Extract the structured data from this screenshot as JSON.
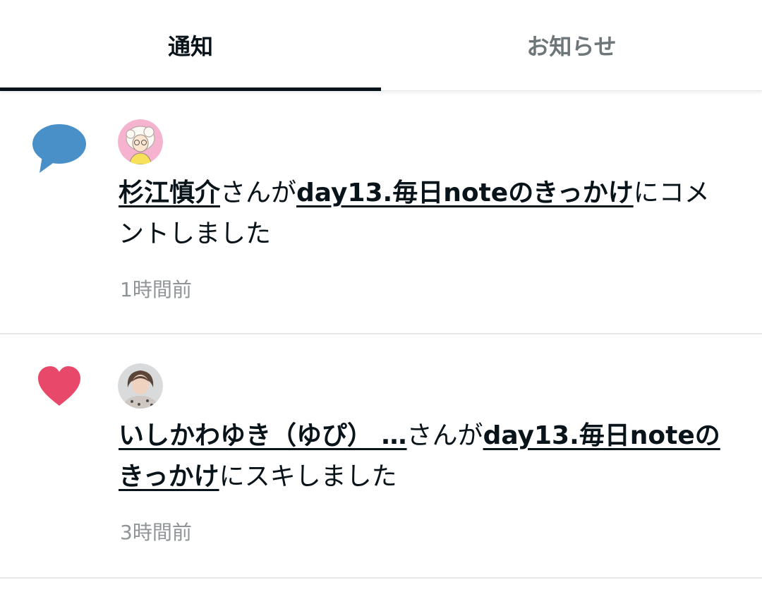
{
  "tabs": [
    {
      "label": "通知",
      "active": true
    },
    {
      "label": "お知らせ",
      "active": false
    }
  ],
  "notifications": [
    {
      "type_icon": "comment-bubble-icon",
      "icon_color": "#4a90c8",
      "user": "杉江慎介",
      "text_mid": "さんが",
      "article": "day13.毎日noteのきっかけ",
      "text_end": "にコメントしました",
      "time": "1時間前"
    },
    {
      "type_icon": "heart-icon",
      "icon_color": "#e8496b",
      "user": "いしかわゆき（ゆぴ） …",
      "text_mid": "さんが",
      "article": "day13.毎日noteのきっかけ",
      "text_end": "にスキしました",
      "time": "3時間前"
    }
  ]
}
